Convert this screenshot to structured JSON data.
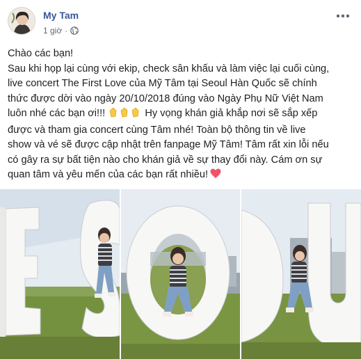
{
  "post": {
    "author": "My Tam",
    "time": "1 giờ",
    "separator": "·",
    "privacy_icon": "globe-icon",
    "more_icon": "more-horizontal-icon",
    "lines": [
      "Chào các bạn!",
      "Sau khi họp lại cùng với ekip, check sân khấu và làm việc lại cuối cùng,",
      "live concert The First Love của Mỹ Tâm tại Seoul Hàn Quốc sẽ chính",
      "thức được dời vào ngày 20/10/2018 đúng vào Ngày Phụ Nữ Việt Nam",
      "luôn nhé các bạn ơi!!!",
      " Hy vọng khán giả khắp nơi sẽ sắp xếp",
      "được và tham gia concert cùng Tâm nhé! Toàn bộ thông tin về live",
      "show và vé sẽ được cập nhật trên fanpage Mỹ Tâm! Tâm rất xin lỗi nếu",
      "có gây ra sự bất tiện nào cho khán giả về sự thay đổi này. Cám ơn sự",
      "quan tâm và yêu mến của các bạn rất nhiều!"
    ],
    "emoji_clap": "clapping-hands-icon",
    "emoji_heart": "heart-icon"
  },
  "photos": [
    {
      "name": "photo-letter-e",
      "letter": "E"
    },
    {
      "name": "photo-letter-o",
      "letter": "O"
    },
    {
      "name": "photo-letter-u",
      "letter": "U"
    }
  ],
  "colors": {
    "author": "#385898",
    "meta": "#606770",
    "text": "#1c1e21",
    "heart": "#f25268",
    "sky": "#dfe8f0",
    "grass": "#6f8d3c"
  }
}
